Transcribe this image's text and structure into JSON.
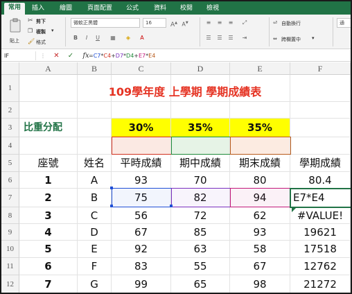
{
  "ribbon": {
    "tabs": [
      "常用",
      "插入",
      "繪圖",
      "頁面配置",
      "公式",
      "資料",
      "校閱",
      "檢視"
    ],
    "paste_label": "貼上",
    "cut_label": "剪下",
    "copy_label": "複製",
    "format_label": "格式",
    "font_name": "微軟正黑體",
    "font_size": "16",
    "bold": "B",
    "italic": "I",
    "underline": "U",
    "wrap_text": "自動換行",
    "merge_center": "跨欄置中",
    "number_format": "通"
  },
  "formula_bar": {
    "name_box": "IF",
    "cancel": "✕",
    "enter": "✓",
    "fx": "fx",
    "formula": "=C7*C4+D7*D4+E7*E4",
    "formula_parts": [
      {
        "text": "=",
        "color": "#333333"
      },
      {
        "text": "C7",
        "color": "#1f4fd6"
      },
      {
        "text": "*",
        "color": "#333333"
      },
      {
        "text": "C4",
        "color": "#d1301f"
      },
      {
        "text": "+",
        "color": "#333333"
      },
      {
        "text": "D7",
        "color": "#7a2fbf"
      },
      {
        "text": "*",
        "color": "#333333"
      },
      {
        "text": "D4",
        "color": "#1f8a3a"
      },
      {
        "text": "+",
        "color": "#333333"
      },
      {
        "text": "E7",
        "color": "#c2177a"
      },
      {
        "text": "*",
        "color": "#333333"
      },
      {
        "text": "E4",
        "color": "#b85a1a"
      }
    ]
  },
  "columns": [
    "A",
    "B",
    "C",
    "D",
    "E",
    "F"
  ],
  "rows": [
    "1",
    "2",
    "3",
    "4",
    "5",
    "6",
    "7",
    "8",
    "9",
    "10",
    "11",
    "12"
  ],
  "sheet": {
    "title": "109學年度 上學期 學期成績表",
    "weight_label": "比重分配",
    "weights": [
      "30%",
      "35%",
      "35%"
    ],
    "headers": [
      "座號",
      "姓名",
      "平時成績",
      "期中成績",
      "期末成績",
      "學期成績"
    ],
    "students": [
      {
        "seat": "1",
        "name": "A",
        "usual": "93",
        "mid": "70",
        "final": "80",
        "term": "80.4"
      },
      {
        "seat": "2",
        "name": "B",
        "usual": "75",
        "mid": "82",
        "final": "94",
        "term": "E7*E4"
      },
      {
        "seat": "3",
        "name": "C",
        "usual": "56",
        "mid": "72",
        "final": "62",
        "term": "#VALUE!"
      },
      {
        "seat": "4",
        "name": "D",
        "usual": "67",
        "mid": "85",
        "final": "93",
        "term": "19621"
      },
      {
        "seat": "5",
        "name": "E",
        "usual": "92",
        "mid": "63",
        "final": "58",
        "term": "17518"
      },
      {
        "seat": "6",
        "name": "F",
        "usual": "83",
        "mid": "55",
        "final": "67",
        "term": "12762"
      },
      {
        "seat": "7",
        "name": "G",
        "usual": "99",
        "mid": "65",
        "final": "98",
        "term": "21272"
      }
    ]
  },
  "colors": {
    "excel_green": "#217346",
    "title_red": "#e53323",
    "weight_yellow": "#ffff00"
  }
}
